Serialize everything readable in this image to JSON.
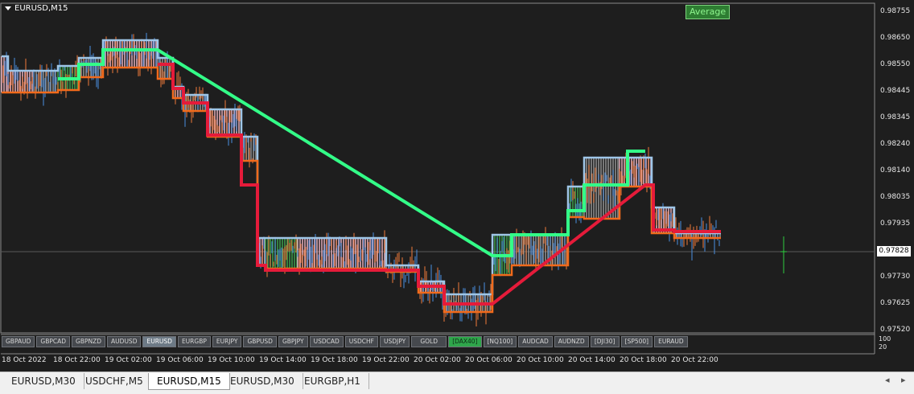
{
  "chart": {
    "title": "EURUSD,M15",
    "average_button": "Average",
    "current_price": "0.97828",
    "price_labels": [
      "0.98755",
      "0.98650",
      "0.98550",
      "0.98445",
      "0.98345",
      "0.98240",
      "0.98140",
      "0.98035",
      "0.97935",
      "0.97730",
      "0.97625",
      "0.97520"
    ],
    "time_labels": [
      "18 Oct 2022",
      "18 Oct 22:00",
      "19 Oct 02:00",
      "19 Oct 06:00",
      "19 Oct 10:00",
      "19 Oct 14:00",
      "19 Oct 18:00",
      "19 Oct 22:00",
      "20 Oct 02:00",
      "20 Oct 06:00",
      "20 Oct 10:00",
      "20 Oct 14:00",
      "20 Oct 18:00",
      "20 Oct 22:00"
    ],
    "subwindow_labels": [
      "100",
      "20"
    ],
    "colors": {
      "background": "#1e1e1e",
      "bull_candle": "#4a90e2",
      "bear_candle": "#f07a3a",
      "upper_band": "#9fc6e8",
      "lower_band": "#f26a1b",
      "avg_up": "#33ff88",
      "avg_down": "#e51b3a",
      "fill_pink": "#f2b8c6",
      "fill_green": "#3fa84f",
      "fill_grey": "#9a9a9a"
    }
  },
  "symbol_buttons": [
    {
      "label": "GBPAUD",
      "state": "normal"
    },
    {
      "label": "GBPCAD",
      "state": "normal"
    },
    {
      "label": "GBPNZD",
      "state": "normal"
    },
    {
      "label": "AUDUSD",
      "state": "normal"
    },
    {
      "label": "EURUSD",
      "state": "active"
    },
    {
      "label": "EURGBP",
      "state": "normal"
    },
    {
      "label": "EURJPY",
      "state": "normal"
    },
    {
      "label": "GBPUSD",
      "state": "normal"
    },
    {
      "label": "GBPJPY",
      "state": "normal"
    },
    {
      "label": "USDCAD",
      "state": "normal"
    },
    {
      "label": "USDCHF",
      "state": "normal"
    },
    {
      "label": "USDJPY",
      "state": "normal"
    },
    {
      "label": "GOLD",
      "state": "normal"
    },
    {
      "label": "[DAX40]",
      "state": "green"
    },
    {
      "label": "[NQ100]",
      "state": "normal"
    },
    {
      "label": "AUDCAD",
      "state": "normal"
    },
    {
      "label": "AUDNZD",
      "state": "normal"
    },
    {
      "label": "[DJI30]",
      "state": "normal"
    },
    {
      "label": "[SP500]",
      "state": "normal"
    },
    {
      "label": "EURAUD",
      "state": "normal"
    }
  ],
  "tabs": [
    {
      "label": "EURUSD,M30",
      "active": false
    },
    {
      "label": "USDCHF,M5",
      "active": false
    },
    {
      "label": "EURUSD,M15",
      "active": true
    },
    {
      "label": "EURUSD,M30",
      "active": false
    },
    {
      "label": "EURGBP,H1",
      "active": false
    }
  ],
  "scroll": {
    "left": "◂",
    "right": "▸"
  }
}
